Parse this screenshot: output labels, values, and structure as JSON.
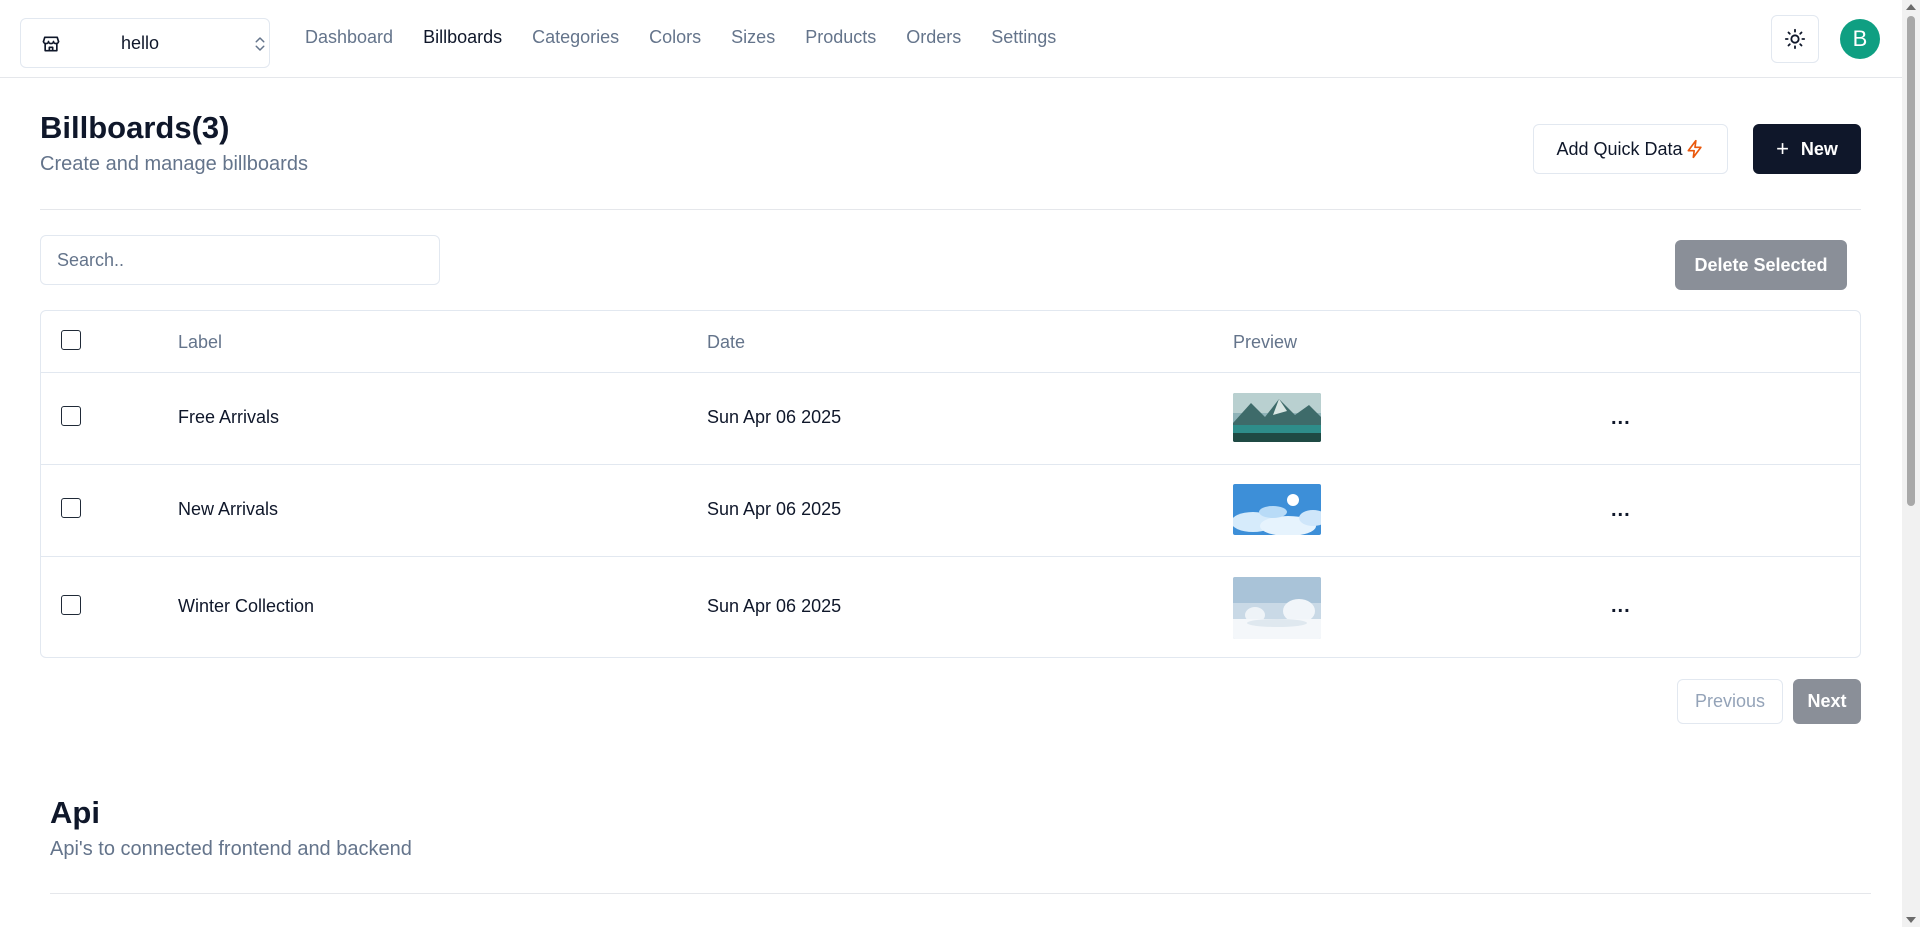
{
  "header": {
    "store_name": "hello",
    "nav": [
      {
        "label": "Dashboard",
        "active": false
      },
      {
        "label": "Billboards",
        "active": true
      },
      {
        "label": "Categories",
        "active": false
      },
      {
        "label": "Colors",
        "active": false
      },
      {
        "label": "Sizes",
        "active": false
      },
      {
        "label": "Products",
        "active": false
      },
      {
        "label": "Orders",
        "active": false
      },
      {
        "label": "Settings",
        "active": false
      }
    ],
    "avatar_initial": "B",
    "theme_icon": "sun-icon"
  },
  "page": {
    "title": "Billboards(3)",
    "subtitle": "Create and manage billboards",
    "quick_data_label": "Add Quick Data",
    "new_label": "New"
  },
  "search": {
    "placeholder": "Search.."
  },
  "delete_selected_label": "Delete Selected",
  "table": {
    "columns": [
      "Label",
      "Date",
      "Preview"
    ],
    "rows": [
      {
        "label": "Free Arrivals",
        "date": "Sun Apr 06 2025",
        "preview": "mountain-lake-image"
      },
      {
        "label": "New Arrivals",
        "date": "Sun Apr 06 2025",
        "preview": "blue-sky-clouds-image"
      },
      {
        "label": "Winter Collection",
        "date": "Sun Apr 06 2025",
        "preview": "snowy-landscape-image"
      }
    ]
  },
  "pagination": {
    "previous_label": "Previous",
    "next_label": "Next"
  },
  "api": {
    "title": "Api",
    "subtitle": "Api's to connected frontend and backend"
  },
  "colors": {
    "primary": "#0f172a",
    "muted": "#64748b",
    "avatar": "#0f9f82",
    "disabled_button": "#8a8f98"
  }
}
